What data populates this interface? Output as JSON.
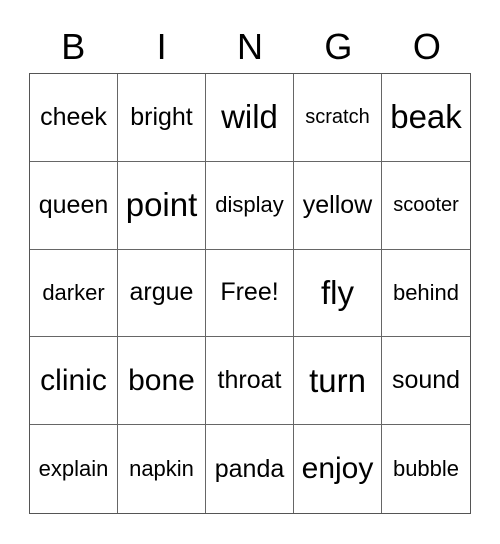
{
  "header": {
    "letters": [
      "B",
      "I",
      "N",
      "G",
      "O"
    ]
  },
  "grid": {
    "rows": [
      [
        "cheek",
        "bright",
        "wild",
        "scratch",
        "beak"
      ],
      [
        "queen",
        "point",
        "display",
        "yellow",
        "scooter"
      ],
      [
        "darker",
        "argue",
        "Free!",
        "fly",
        "behind"
      ],
      [
        "clinic",
        "bone",
        "throat",
        "turn",
        "sound"
      ],
      [
        "explain",
        "napkin",
        "panda",
        "enjoy",
        "bubble"
      ]
    ]
  }
}
